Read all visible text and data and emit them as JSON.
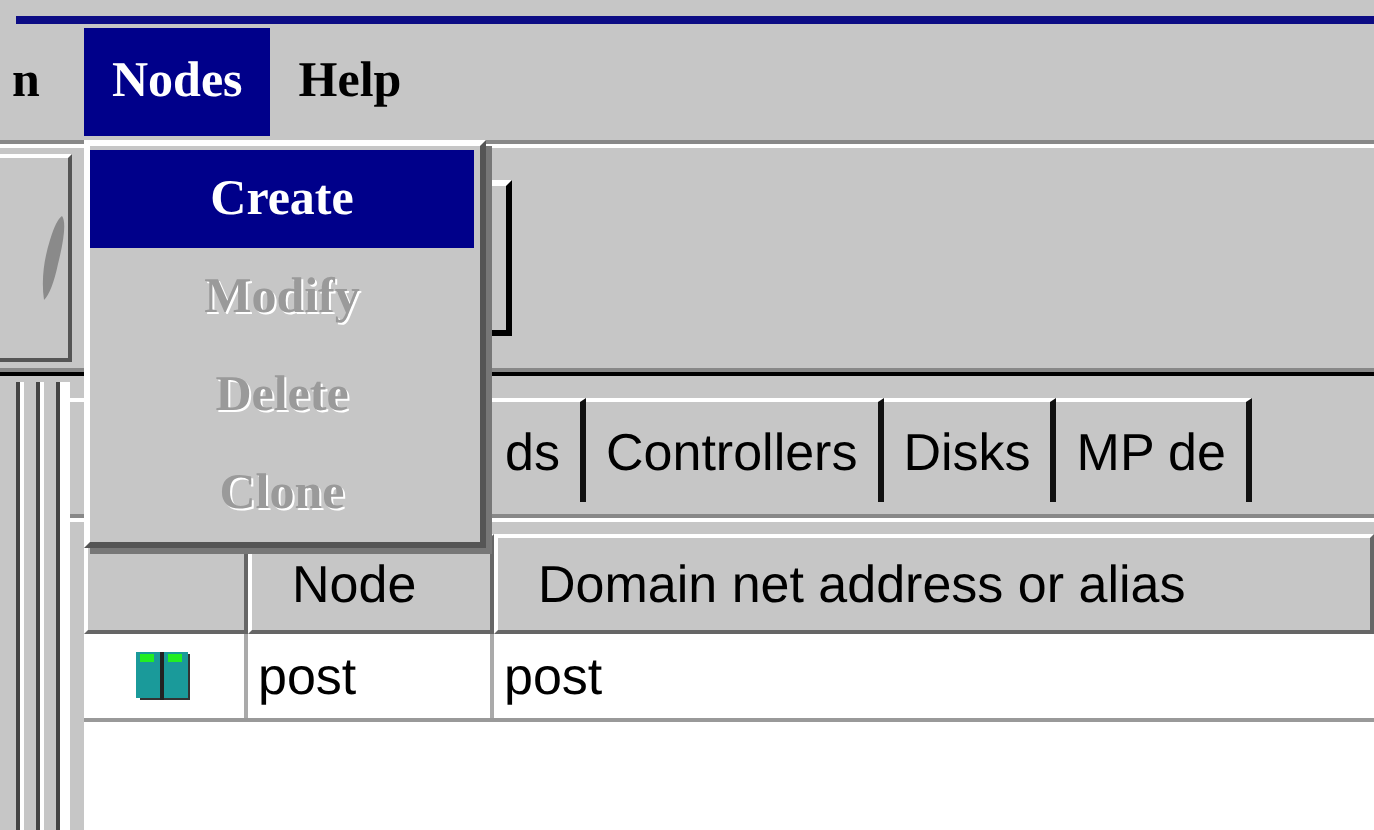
{
  "menu_bar": [
    {
      "label": "n",
      "selected": false
    },
    {
      "label": "Nodes",
      "selected": true
    },
    {
      "label": "Help",
      "selected": false
    }
  ],
  "nodes_menu": [
    {
      "label": "Create",
      "selected": true,
      "disabled": false
    },
    {
      "label": "Modify",
      "selected": false,
      "disabled": true
    },
    {
      "label": "Delete",
      "selected": false,
      "disabled": true
    },
    {
      "label": "Clone",
      "selected": false,
      "disabled": true
    }
  ],
  "tabs": [
    {
      "label": "ds"
    },
    {
      "label": "Controllers"
    },
    {
      "label": "Disks"
    },
    {
      "label": "MP de"
    }
  ],
  "table": {
    "columns": [
      "",
      "Node",
      "Domain net address or alias"
    ],
    "rows": [
      {
        "node": "post",
        "domain": "post"
      }
    ]
  }
}
